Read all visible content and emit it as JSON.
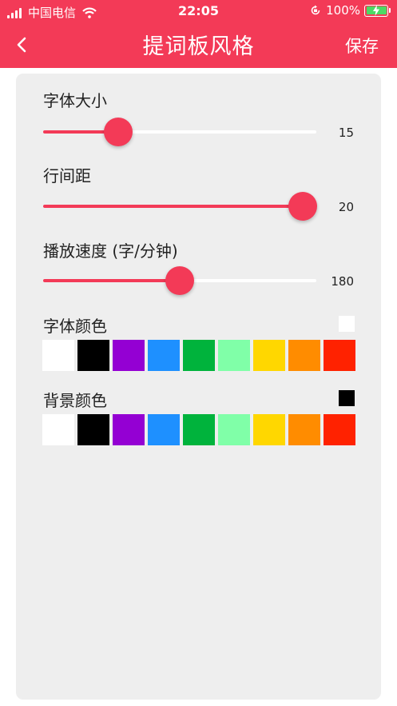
{
  "status_bar": {
    "carrier": "中国电信",
    "time": "22:05",
    "battery": "100%"
  },
  "nav": {
    "title": "提词板风格",
    "save_label": "保存"
  },
  "sliders": [
    {
      "label": "字体大小",
      "value": "15",
      "fraction": 0.275
    },
    {
      "label": "行间距",
      "value": "20",
      "fraction": 0.95
    },
    {
      "label": "播放速度 (字/分钟)",
      "value": "180",
      "fraction": 0.5
    }
  ],
  "font_color": {
    "label": "字体颜色",
    "selected": "#ffffff"
  },
  "bg_color": {
    "label": "背景颜色",
    "selected": "#000000"
  },
  "palette": [
    "#ffffff",
    "#000000",
    "#9400d3",
    "#1e90ff",
    "#00b33c",
    "#80ffa8",
    "#ffd700",
    "#ff8c00",
    "#ff2200"
  ],
  "accent": "#f33a57"
}
